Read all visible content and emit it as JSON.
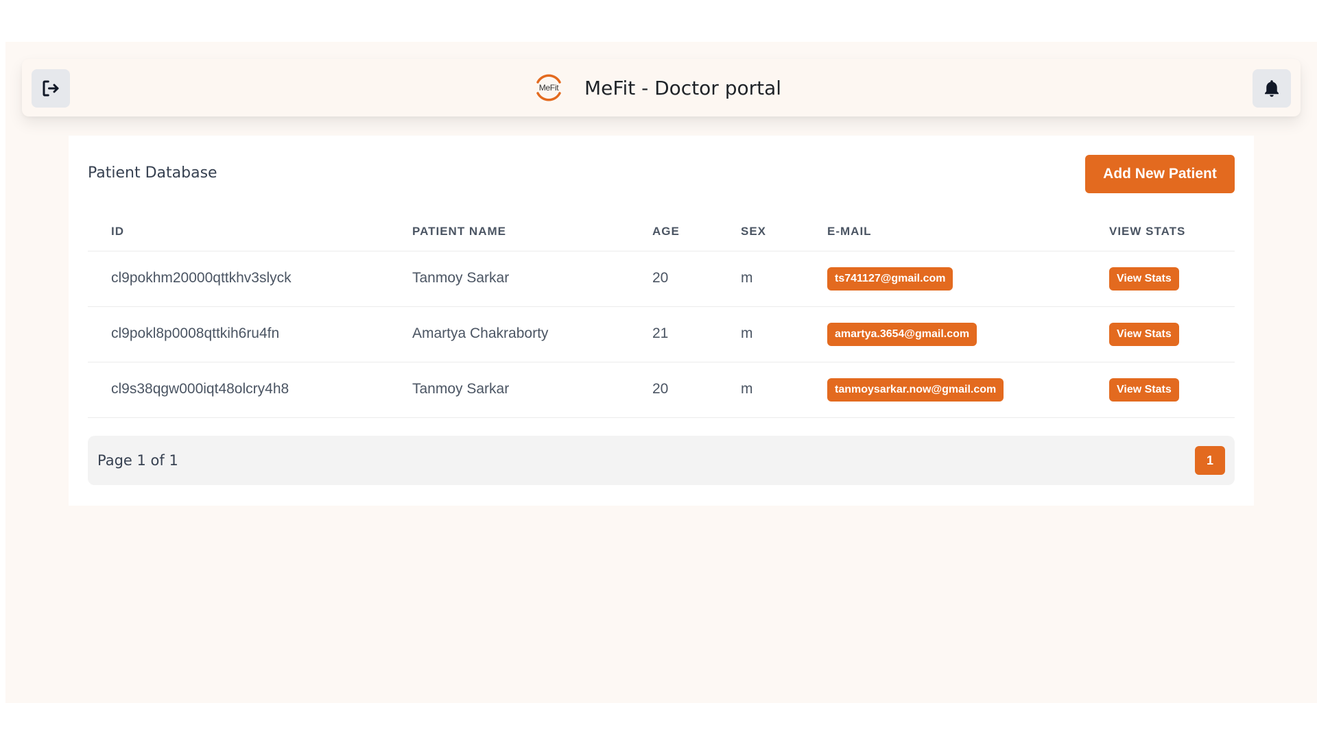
{
  "header": {
    "title": "MeFit - Doctor portal",
    "logo_text": "MeFit",
    "logout_icon": "logout-icon",
    "notifications_icon": "bell-icon"
  },
  "colors": {
    "accent": "#e36a1f",
    "background": "#fdf8f4"
  },
  "main": {
    "title": "Patient Database",
    "add_button_label": "Add New Patient",
    "table": {
      "columns": [
        "ID",
        "PATIENT NAME",
        "AGE",
        "SEX",
        "E-MAIL",
        "VIEW STATS"
      ],
      "rows": [
        {
          "id": "cl9pokhm20000qttkhv3slyck",
          "name": "Tanmoy Sarkar",
          "age": "20",
          "sex": "m",
          "email": "ts741127@gmail.com",
          "stats_label": "View Stats"
        },
        {
          "id": "cl9pokl8p0008qttkih6ru4fn",
          "name": "Amartya Chakraborty",
          "age": "21",
          "sex": "m",
          "email": "amartya.3654@gmail.com",
          "stats_label": "View Stats"
        },
        {
          "id": "cl9s38qgw000iqt48olcry4h8",
          "name": "Tanmoy Sarkar",
          "age": "20",
          "sex": "m",
          "email": "tanmoysarkar.now@gmail.com",
          "stats_label": "View Stats"
        }
      ]
    },
    "pagination": {
      "text": "Page 1 of 1",
      "current_page": "1"
    }
  }
}
